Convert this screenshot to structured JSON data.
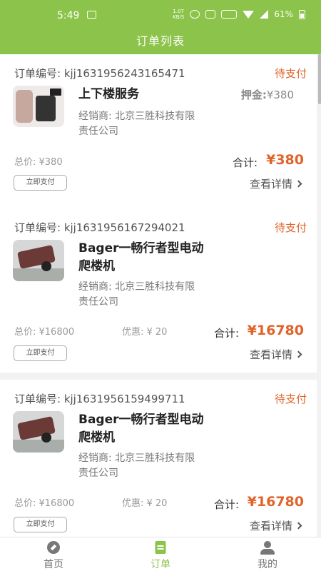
{
  "status_bar": {
    "time": "5:49",
    "net_speed_value": "1.07",
    "net_speed_unit": "KB/S",
    "signal_tag": "4G",
    "battery": "61%"
  },
  "header": {
    "title": "订单列表"
  },
  "orders": [
    {
      "order_no": "订单编号: kjj1631956243165471",
      "status": "待支付",
      "product_name": "上下楼服务",
      "deposit_label": "押金:",
      "deposit_value": "¥380",
      "dealer_line1": "经销商: 北京三胜科技有限",
      "dealer_line2": "责任公司",
      "total_price": "总价: ¥380",
      "sum_label": "合计:",
      "sum_value": "¥380",
      "pay_button": "立即支付",
      "detail_link": "查看详情",
      "thumbnail": "stair-service-photo"
    },
    {
      "order_no": "订单编号: kjj1631956167294021",
      "status": "待支付",
      "product_name_line1": "Bager一畅行者型电动",
      "product_name_line2": "爬楼机",
      "dealer_line1": "经销商: 北京三胜科技有限",
      "dealer_line2": "责任公司",
      "total_price": "总价: ¥16800",
      "discount": "优惠: ¥ 20",
      "sum_label": "合计:",
      "sum_value": "¥16780",
      "pay_button": "立即支付",
      "detail_link": "查看详情",
      "thumbnail": "stair-climber-photo"
    },
    {
      "order_no": "订单编号: kjj1631956159499711",
      "status": "待支付",
      "product_name_line1": "Bager一畅行者型电动",
      "product_name_line2": "爬楼机",
      "dealer_line1": "经销商: 北京三胜科技有限",
      "dealer_line2": "责任公司",
      "total_price": "总价: ¥16800",
      "discount": "优惠: ¥ 20",
      "sum_label": "合计:",
      "sum_value": "¥16780",
      "pay_button": "立即支付",
      "detail_link": "查看详情",
      "thumbnail": "stair-climber-photo"
    }
  ],
  "tabbar": {
    "home": "首页",
    "orders": "订单",
    "mine": "我的",
    "active": "orders"
  },
  "colors": {
    "brand": "#8cc34a",
    "accent": "#e0632a"
  }
}
